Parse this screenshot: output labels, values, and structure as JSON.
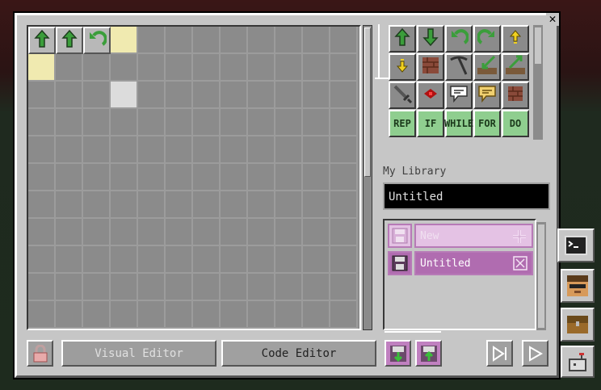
{
  "window": {
    "close_icon": "close-icon"
  },
  "grid": {
    "columns": 12,
    "rows": 11,
    "placed_tiles": [
      {
        "row": 0,
        "col": 0,
        "icon": "arrow-up-icon",
        "color": "#3b9e3b"
      },
      {
        "row": 0,
        "col": 1,
        "icon": "arrow-up-icon",
        "color": "#3b9e3b"
      },
      {
        "row": 0,
        "col": 2,
        "icon": "rotate-left-icon",
        "color": "#3b9e3b"
      }
    ],
    "highlighted_cells": [
      {
        "row": 0,
        "col": 3,
        "style": "yellow"
      },
      {
        "row": 1,
        "col": 0,
        "style": "yellow"
      },
      {
        "row": 2,
        "col": 3,
        "style": "white"
      }
    ]
  },
  "palette": {
    "items": [
      {
        "icon": "arrow-up-icon",
        "label": "",
        "kind": "move-forward"
      },
      {
        "icon": "arrow-down-icon",
        "label": "",
        "kind": "move-back"
      },
      {
        "icon": "rotate-left-icon",
        "label": "",
        "kind": "turn-left"
      },
      {
        "icon": "rotate-right-icon",
        "label": "",
        "kind": "turn-right"
      },
      {
        "icon": "arrow-up-yellow-icon",
        "label": "",
        "kind": "move-up"
      },
      {
        "icon": "arrow-down-yellow-icon",
        "label": "",
        "kind": "move-down"
      },
      {
        "icon": "block-icon",
        "label": "",
        "kind": "place-block"
      },
      {
        "icon": "pickaxe-icon",
        "label": "",
        "kind": "mine"
      },
      {
        "icon": "dig-down-icon",
        "label": "",
        "kind": "dig-down"
      },
      {
        "icon": "dig-up-icon",
        "label": "",
        "kind": "dig-up"
      },
      {
        "icon": "sword-icon",
        "label": "",
        "kind": "attack"
      },
      {
        "icon": "redstone-icon",
        "label": "",
        "kind": "redstone"
      },
      {
        "icon": "speech-white-icon",
        "label": "",
        "kind": "say"
      },
      {
        "icon": "speech-yellow-icon",
        "label": "",
        "kind": "think"
      },
      {
        "icon": "block-small-icon",
        "label": "",
        "kind": "place-block-2"
      },
      {
        "icon": "",
        "label": "REP",
        "kind": "repeat"
      },
      {
        "icon": "",
        "label": "IF",
        "kind": "if"
      },
      {
        "icon": "",
        "label": "WHILE",
        "kind": "while"
      },
      {
        "icon": "",
        "label": "FOR",
        "kind": "for"
      },
      {
        "icon": "",
        "label": "DO",
        "kind": "do"
      }
    ]
  },
  "library": {
    "label": "My Library",
    "name_value": "Untitled",
    "entries": [
      {
        "name": "New",
        "state": "disabled",
        "left_icon": "save-icon",
        "right_icon": "add-icon"
      },
      {
        "name": "Untitled",
        "state": "selected",
        "left_icon": "save-icon",
        "right_icon": "delete-icon"
      }
    ]
  },
  "bottom_bar": {
    "lock_icon": "lock-icon",
    "visual_editor_label": "Visual Editor",
    "code_editor_label": "Code Editor",
    "import_icon": "import-icon",
    "export_icon": "export-icon",
    "step_icon": "step-icon",
    "run_icon": "play-icon"
  },
  "side_tabs": [
    {
      "icon": "terminal-icon",
      "active": true
    },
    {
      "icon": "player-head-icon",
      "active": false
    },
    {
      "icon": "chest-icon",
      "active": false
    },
    {
      "icon": "robot-icon",
      "active": false
    }
  ],
  "colors": {
    "selected_row": "#b06cb0",
    "disabled_row": "#e4c2e4",
    "green_tile": "#8fce8f",
    "yellow_cell": "#f0eab0"
  }
}
